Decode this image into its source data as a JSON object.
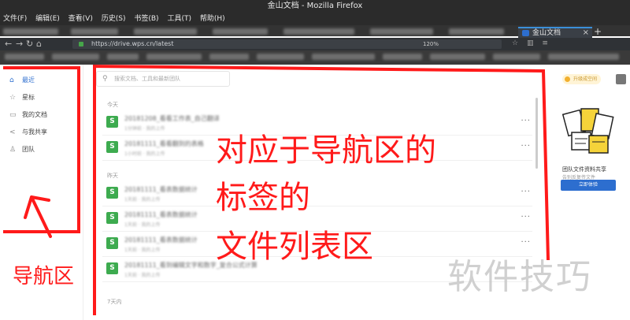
{
  "window": {
    "title": "金山文档 - Mozilla Firefox"
  },
  "menu": [
    "文件(F)",
    "编辑(E)",
    "查看(V)",
    "历史(S)",
    "书签(B)",
    "工具(T)",
    "帮助(H)"
  ],
  "tab": {
    "label": "金山文档",
    "close": "×",
    "new": "+"
  },
  "address": {
    "url": "https://drive.wps.cn/latest",
    "zoom": "120%"
  },
  "nav_icons": [
    "back-arrow-icon",
    "forward-arrow-icon",
    "reload-icon",
    "home-icon"
  ],
  "sidebar": {
    "items": [
      {
        "label": "最近",
        "icon": "home-icon"
      },
      {
        "label": "星标",
        "icon": "star-icon"
      },
      {
        "label": "我的文档",
        "icon": "document-icon"
      },
      {
        "label": "与我共享",
        "icon": "share-icon"
      },
      {
        "label": "团队",
        "icon": "team-icon"
      }
    ]
  },
  "search": {
    "placeholder": "搜索文档、工具和最新团队"
  },
  "groups": {
    "today": "今天",
    "yesterday": "昨天",
    "week": "7天内"
  },
  "files": [
    {
      "icon": "S",
      "name": "20181208_看看工作表_自己翻译",
      "meta": "1分钟前 · 我的上传"
    },
    {
      "icon": "S",
      "name": "20181111_看看翻到的表格",
      "meta": "1小时前 · 我的上传"
    },
    {
      "icon": "S",
      "name": "20181111_看表数据统计",
      "meta": "1天前 · 我的上传"
    },
    {
      "icon": "S",
      "name": "20181111_看表数据统计",
      "meta": "1天前 · 我的上传"
    },
    {
      "icon": "S",
      "name": "20181111_看表数据统计",
      "meta": "1天前 · 我的上传"
    },
    {
      "icon": "S",
      "name": "20181111_看到编辑文字和数字_复合公式计算",
      "meta": "1天前 · 我的上传"
    }
  ],
  "more_label": "···",
  "right_panel": {
    "upgrade": "升级成空间",
    "promo_title": "团队文件资料共享",
    "promo_sub": "告别反复传文件",
    "promo_button": "立即体验"
  },
  "annotations": {
    "nav_label": "导航区",
    "main_line1": "对应于导航区的",
    "main_line2": "标签的",
    "main_line3": "文件列表区"
  },
  "watermark": "软件技巧",
  "colors": {
    "annotation": "#ff1a1a",
    "accent": "#2d6ecf",
    "sheet_icon": "#3dab4f"
  }
}
